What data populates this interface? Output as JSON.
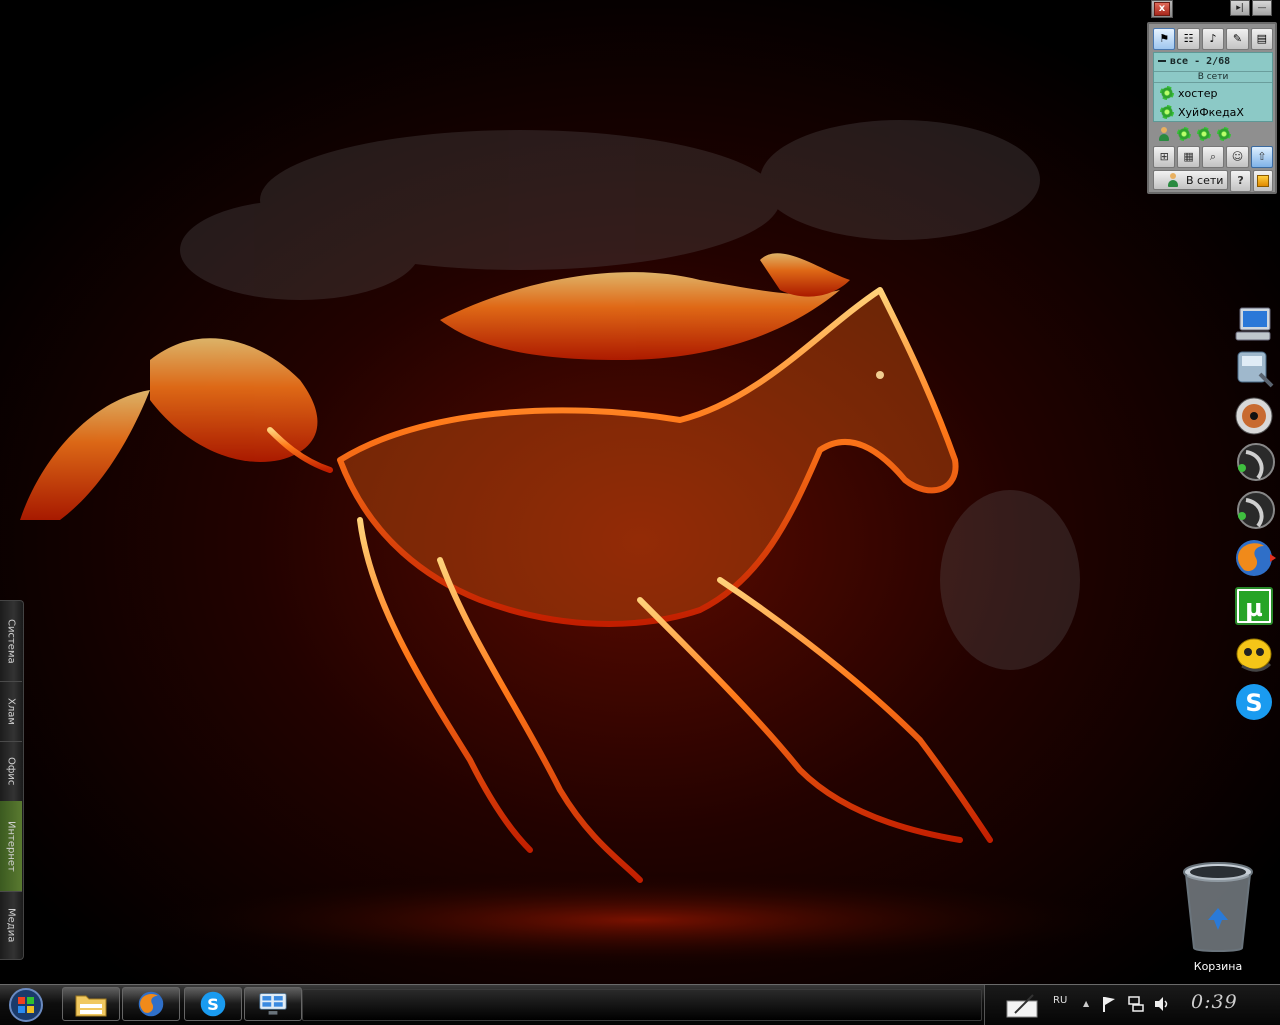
{
  "qip": {
    "close_label": "x",
    "pin_label": "▸|",
    "minimize_label": "—",
    "tabs": [
      "flag-icon",
      "contacts-icon",
      "speaker-icon",
      "notes-icon",
      "notepad-icon"
    ],
    "group_label": "все - 2/68",
    "subgroup_label": "В сети",
    "contacts": [
      "хостер",
      "ХуйФкедаХ"
    ],
    "status_label": "В сети",
    "help_label": "?"
  },
  "side_tabs": [
    "Система",
    "Хлам",
    "Офис",
    "Интернет",
    "Медиа"
  ],
  "side_tab_active": "Интернет",
  "dock": [
    "computer-icon",
    "control-panel-icon",
    "dvd-icon",
    "ventrilo-icon",
    "ventrilo-icon-2",
    "firefox-icon",
    "utorrent-icon",
    "qip-icon",
    "skype-icon"
  ],
  "recycle_bin": {
    "label": "Корзина"
  },
  "taskbar": {
    "pinned": [
      "explorer-icon",
      "firefox-icon",
      "skype-icon",
      "network-icon"
    ]
  },
  "tray": {
    "language": "RU",
    "show_hidden_label": "▲",
    "clock": "0:39"
  }
}
